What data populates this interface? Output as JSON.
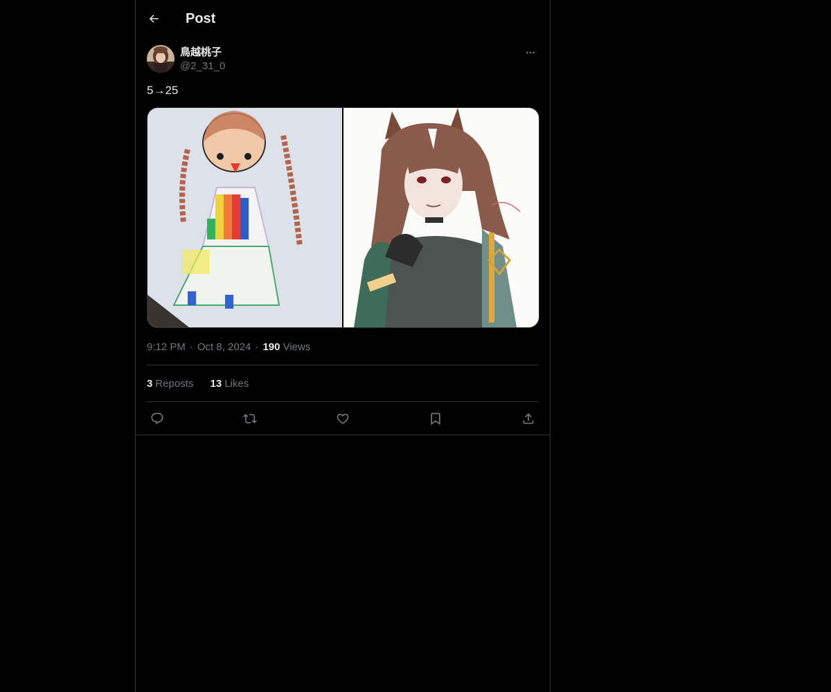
{
  "header": {
    "title": "Post",
    "back_icon": "arrow-left-icon"
  },
  "author": {
    "display_name": "鳥越桃子",
    "handle": "@2_31_0"
  },
  "post": {
    "text": "5→25",
    "media": [
      {
        "kind": "child-crayon-drawing"
      },
      {
        "kind": "anime-watercolor-illustration"
      }
    ]
  },
  "meta": {
    "time": "9:12 PM",
    "date": "Oct 8, 2024",
    "separator": "·",
    "views_count": "190",
    "views_label": "Views"
  },
  "stats": {
    "reposts_count": "3",
    "reposts_label": "Reposts",
    "likes_count": "13",
    "likes_label": "Likes"
  },
  "actions": [
    {
      "icon": "reply-icon"
    },
    {
      "icon": "repost-icon"
    },
    {
      "icon": "like-icon"
    },
    {
      "icon": "bookmark-icon"
    },
    {
      "icon": "share-icon"
    }
  ],
  "colors": {
    "background": "#000000",
    "text": "#e7e9ea",
    "secondary_text": "#71767b",
    "border": "#2f3336"
  }
}
